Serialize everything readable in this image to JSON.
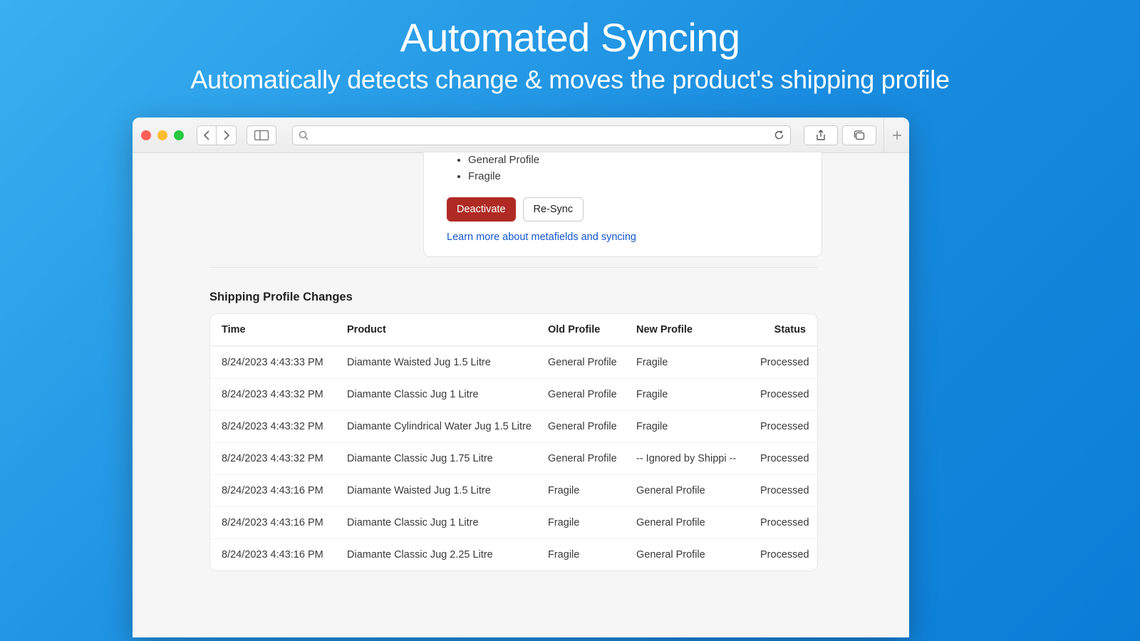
{
  "hero": {
    "title": "Automated Syncing",
    "subtitle": "Automatically detects change & moves the product's shipping profile"
  },
  "card": {
    "bullets": [
      "General Profile",
      "Fragile"
    ],
    "deactivate_label": "Deactivate",
    "resync_label": "Re-Sync",
    "link_label": "Learn more about metafields and syncing"
  },
  "section_title": "Shipping Profile Changes",
  "table": {
    "headers": {
      "time": "Time",
      "product": "Product",
      "old": "Old Profile",
      "new": "New Profile",
      "status": "Status"
    },
    "rows": [
      {
        "time": "8/24/2023 4:43:33 PM",
        "product": "Diamante Waisted Jug 1.5 Litre",
        "old": "General Profile",
        "new": "Fragile",
        "status": "Processed"
      },
      {
        "time": "8/24/2023 4:43:32 PM",
        "product": "Diamante Classic Jug 1 Litre",
        "old": "General Profile",
        "new": "Fragile",
        "status": "Processed"
      },
      {
        "time": "8/24/2023 4:43:32 PM",
        "product": "Diamante Cylindrical Water Jug 1.5 Litre",
        "old": "General Profile",
        "new": "Fragile",
        "status": "Processed"
      },
      {
        "time": "8/24/2023 4:43:32 PM",
        "product": "Diamante Classic Jug 1.75 Litre",
        "old": "General Profile",
        "new": "-- Ignored by Shippi --",
        "status": "Processed"
      },
      {
        "time": "8/24/2023 4:43:16 PM",
        "product": "Diamante Waisted Jug 1.5 Litre",
        "old": "Fragile",
        "new": "General Profile",
        "status": "Processed"
      },
      {
        "time": "8/24/2023 4:43:16 PM",
        "product": "Diamante Classic Jug 1 Litre",
        "old": "Fragile",
        "new": "General Profile",
        "status": "Processed"
      },
      {
        "time": "8/24/2023 4:43:16 PM",
        "product": "Diamante Classic Jug 2.25 Litre",
        "old": "Fragile",
        "new": "General Profile",
        "status": "Processed"
      }
    ]
  }
}
